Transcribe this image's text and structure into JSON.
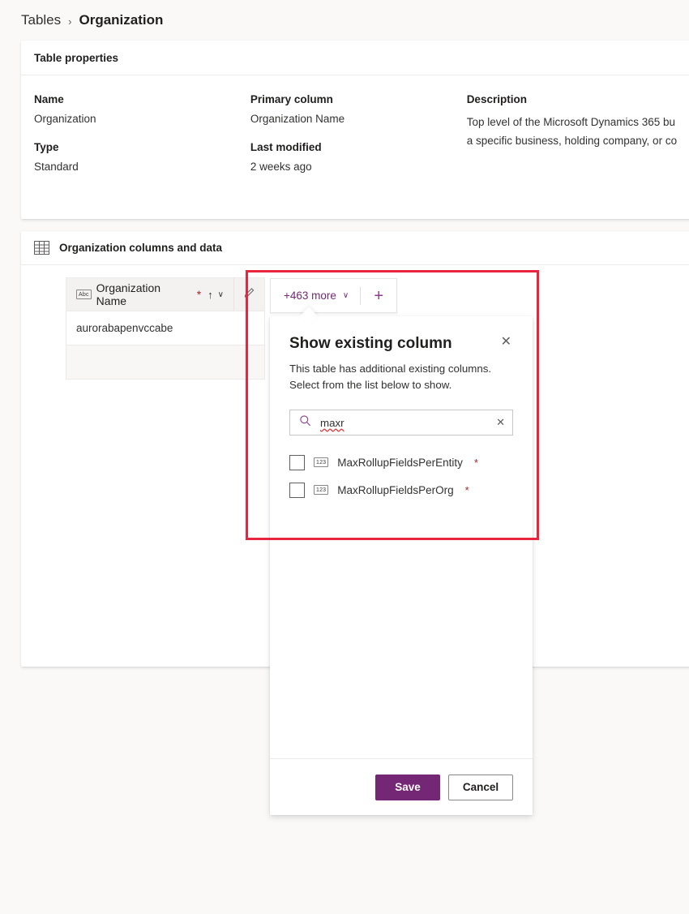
{
  "breadcrumb": {
    "parent": "Tables",
    "separator": "›",
    "current": "Organization"
  },
  "properties_card": {
    "header_title": "Table properties",
    "fields": [
      {
        "label": "Name",
        "value": "Organization"
      },
      {
        "label": "Type",
        "value": "Standard"
      },
      {
        "label": "Primary column",
        "value": "Organization Name"
      },
      {
        "label": "Last modified",
        "value": "2 weeks ago"
      }
    ],
    "description_label": "Description",
    "description_line1": "Top level of the Microsoft Dynamics 365 bu",
    "description_line2": "a specific business, holding company, or co"
  },
  "columns_card": {
    "icon": "table-icon",
    "header_title": "Organization columns and data",
    "grid": {
      "primary_column": {
        "type_badge": "Abc",
        "label": "Organization Name",
        "required_marker": "*",
        "sort_indicator": "↑",
        "chevron": "∨"
      },
      "edit_column_icon": "edit-pencil-icon",
      "rows": [
        {
          "organization_name": "aurorabapenvccabe"
        },
        {
          "organization_name": ""
        }
      ]
    },
    "toolbar": {
      "more_label": "+463 more",
      "more_chevron": "∨",
      "add_button_icon": "plus-icon",
      "add_button_glyph": "+"
    }
  },
  "callout": {
    "title": "Show existing column",
    "close_icon": "close-icon",
    "close_glyph": "✕",
    "subtitle_line1": "This table has additional existing columns.",
    "subtitle_line2": "Select from the list below to show.",
    "search": {
      "icon": "search-icon",
      "value": "maxr",
      "placeholder": "Search",
      "clear_icon": "clear-icon",
      "clear_glyph": "✕"
    },
    "results": [
      {
        "type_badge": "123",
        "name": "MaxRollupFieldsPerEntity",
        "required_marker": "*",
        "checked": false
      },
      {
        "type_badge": "123",
        "name": "MaxRollupFieldsPerOrg",
        "required_marker": "*",
        "checked": false
      }
    ],
    "footer": {
      "save_label": "Save",
      "cancel_label": "Cancel"
    }
  },
  "annotation": {
    "highlight_color": "#e8253f"
  },
  "theme": {
    "accent": "#742774",
    "page_background": "#faf9f8",
    "required_color": "#a4262c"
  }
}
